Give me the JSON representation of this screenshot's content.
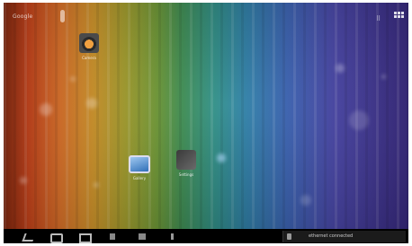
{
  "status_bar": {
    "left_text": "Google",
    "mic_icon": "microphone-icon",
    "apps_icon": "app-drawer-icon"
  },
  "home_icons": [
    {
      "name": "camera-icon",
      "label": "Camera"
    },
    {
      "name": "gallery-icon",
      "label": "Gallery"
    },
    {
      "name": "settings-icon",
      "label": "Settings"
    }
  ],
  "navbar": {
    "buttons": [
      "back-icon",
      "home-icon",
      "recent-apps-icon",
      "volume-down-icon",
      "volume-up-icon",
      "menu-icon"
    ],
    "notification_text": "ethernet connected"
  },
  "colors": {
    "wallpaper_left": "#d4461b",
    "wallpaper_middle": "#3e8f52",
    "wallpaper_right": "#3a2a86",
    "navbar": "#000000"
  }
}
